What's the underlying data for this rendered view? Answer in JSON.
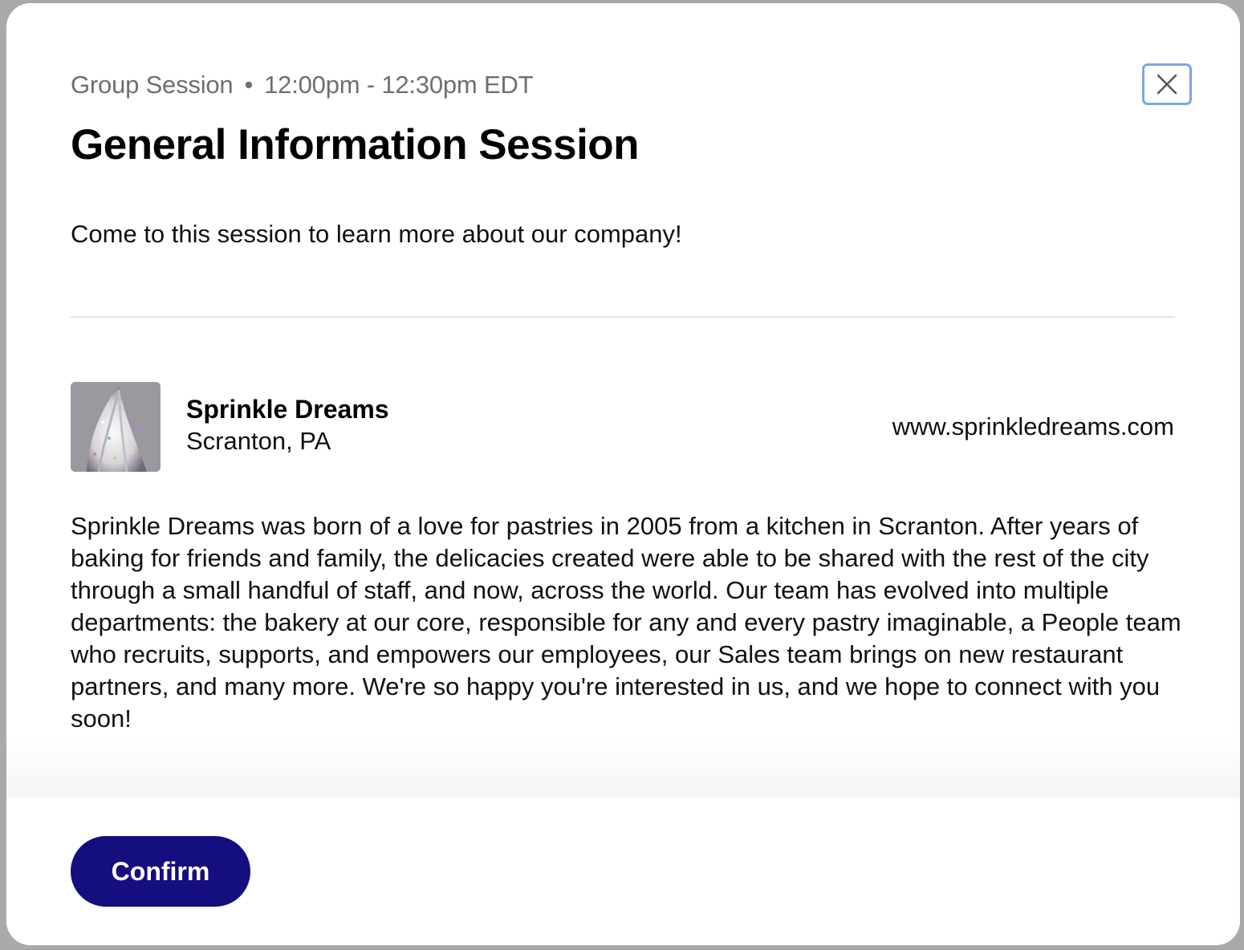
{
  "session": {
    "type": "Group Session",
    "separator": "•",
    "time": "12:00pm - 12:30pm EDT",
    "title": "General Information Session",
    "description": "Come to this session to learn more about our company!"
  },
  "company": {
    "name": "Sprinkle Dreams",
    "location": "Scranton, PA",
    "website": "www.sprinkledreams.com",
    "about": "Sprinkle Dreams was born of a love for pastries in 2005 from a kitchen in Scranton. After years of baking for friends and family, the delicacies created were able to be shared with the rest of the city through a small handful of staff, and now, across the world. Our team has evolved into multiple departments: the bakery at our core, responsible for any and every pastry imaginable, a People team who recruits, supports, and empowers our employees, our Sales team brings on new restaurant partners, and many more. We're so happy you're interested in us, and we hope to connect with you soon!"
  },
  "actions": {
    "confirm_label": "Confirm",
    "close_icon": "close-icon"
  },
  "colors": {
    "confirm_bg": "#150e7f",
    "close_focus_ring": "#7ea5e6",
    "meta_text": "#6e6e73"
  }
}
